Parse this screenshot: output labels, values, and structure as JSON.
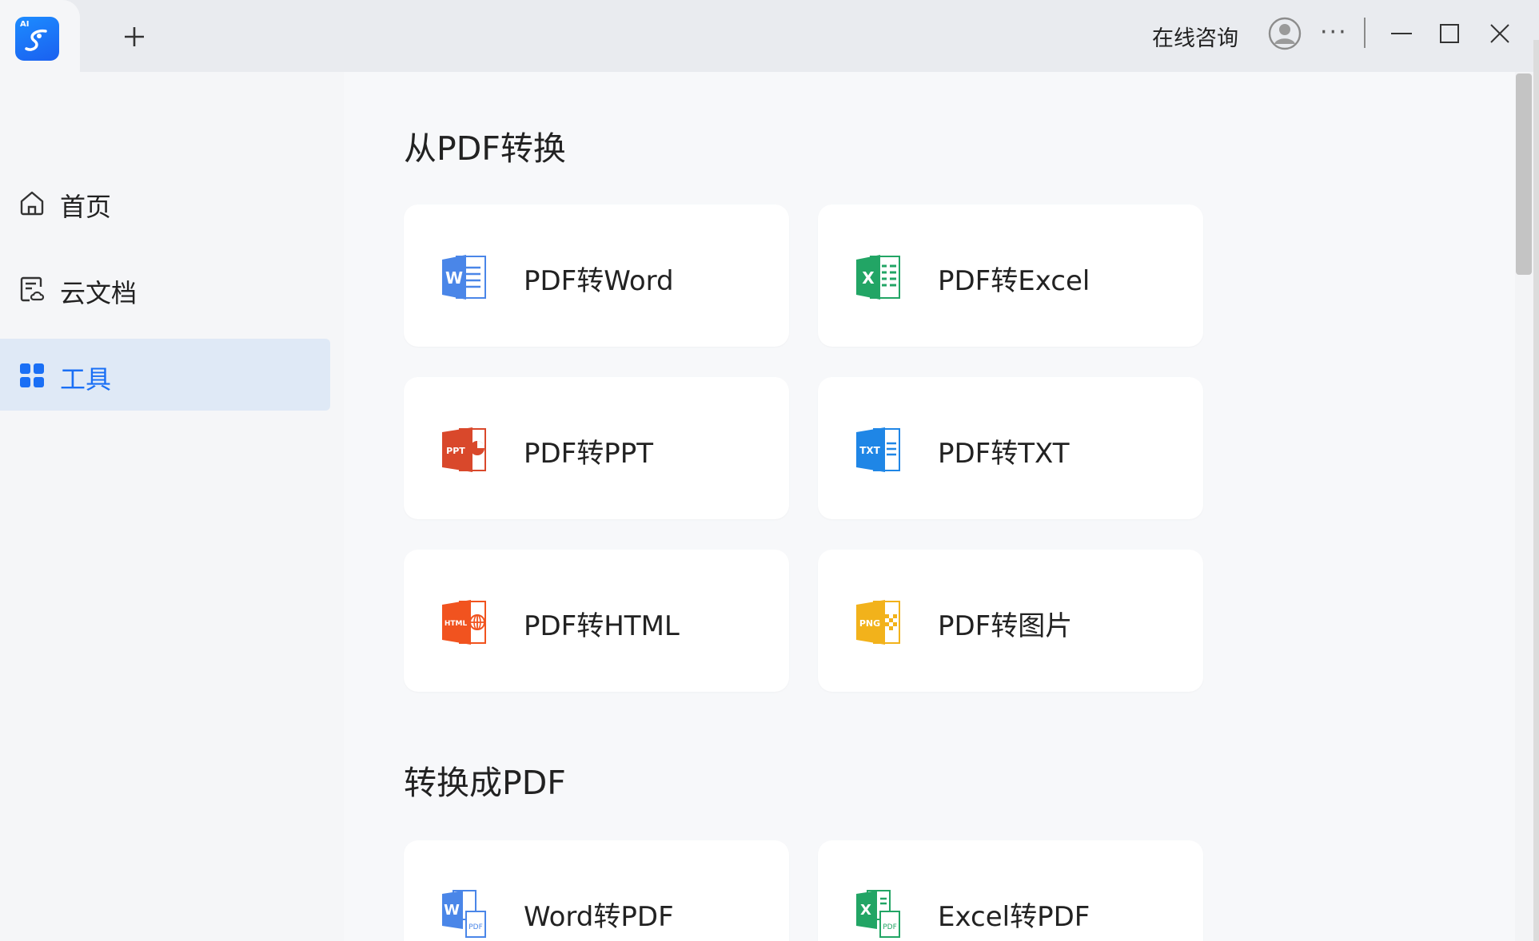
{
  "titlebar": {
    "logo_text": "AI",
    "consult_label": "在线咨询",
    "more_label": "···"
  },
  "sidebar": {
    "items": [
      {
        "label": "首页",
        "icon": "home-icon",
        "active": false
      },
      {
        "label": "云文档",
        "icon": "cloud-doc-icon",
        "active": false
      },
      {
        "label": "工具",
        "icon": "grid-apps-icon",
        "active": true
      }
    ]
  },
  "main": {
    "from_pdf": {
      "title": "从PDF转换",
      "cards": [
        {
          "label": "PDF转Word",
          "icon": "word-icon",
          "badge": "W",
          "color": "#4a86e8"
        },
        {
          "label": "PDF转Excel",
          "icon": "excel-icon",
          "badge": "X",
          "color": "#22a565"
        },
        {
          "label": "PDF转PPT",
          "icon": "ppt-icon",
          "badge": "PPT",
          "color": "#d9482b"
        },
        {
          "label": "PDF转TXT",
          "icon": "txt-icon",
          "badge": "TXT",
          "color": "#1f86e6"
        },
        {
          "label": "PDF转HTML",
          "icon": "html-icon",
          "badge": "HTML",
          "color": "#f1531f"
        },
        {
          "label": "PDF转图片",
          "icon": "image-icon",
          "badge": "PNG",
          "color": "#f2b21b"
        }
      ]
    },
    "to_pdf": {
      "title": "转换成PDF",
      "cards": [
        {
          "label": "Word转PDF",
          "icon": "word-to-pdf-icon",
          "badge": "W",
          "sub": "PDF",
          "color": "#4a86e8"
        },
        {
          "label": "Excel转PDF",
          "icon": "excel-to-pdf-icon",
          "badge": "X",
          "sub": "PDF",
          "color": "#22a565"
        }
      ]
    }
  },
  "colors": {
    "accent": "#1a6ff5",
    "active_bg": "#dfe9f6"
  }
}
